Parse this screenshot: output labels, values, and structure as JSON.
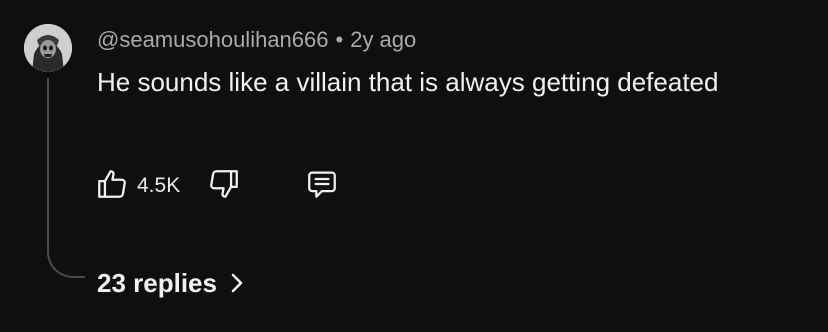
{
  "comment": {
    "author": "@seamusohoulihan666",
    "separator": "•",
    "timestamp": "2y ago",
    "text": "He sounds like a villain that is always getting defeated",
    "like_count": "4.5K",
    "replies_label": "23 replies"
  },
  "icons": {
    "like": "thumbs-up-icon",
    "dislike": "thumbs-down-icon",
    "reply": "comment-icon",
    "replies_chevron": "chevron-right-icon"
  },
  "colors": {
    "background": "#0f0f0f",
    "primary_text": "#f1f1f1",
    "secondary_text": "#aaaaaa"
  }
}
